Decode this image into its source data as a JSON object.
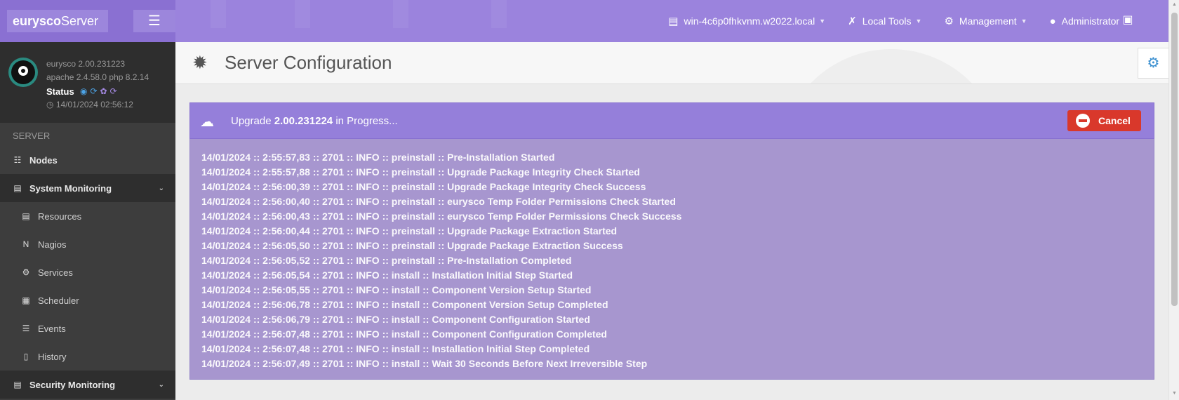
{
  "topbar": {
    "brand_bold": "eurysco",
    "brand_rest": "Server",
    "host": "win-4c6p0fhkvnm.w2022.local",
    "local_tools": "Local Tools",
    "management": "Management",
    "user": "Administrator"
  },
  "sidebar": {
    "version": "eurysco 2.00.231223",
    "stack": "apache 2.4.58.0  php 8.2.14",
    "status_label": "Status",
    "timestamp": "14/01/2024 02:56:12",
    "section": "SERVER",
    "items": [
      {
        "label": "Nodes",
        "icon": "sitemap-icon"
      },
      {
        "label": "System Monitoring",
        "icon": "monitor-icon"
      },
      {
        "label": "Resources",
        "icon": "server-icon"
      },
      {
        "label": "Nagios",
        "icon": "nagios-icon"
      },
      {
        "label": "Services",
        "icon": "cog-icon"
      },
      {
        "label": "Scheduler",
        "icon": "calendar-icon"
      },
      {
        "label": "Events",
        "icon": "list-icon"
      },
      {
        "label": "History",
        "icon": "book-icon"
      },
      {
        "label": "Security Monitoring",
        "icon": "shield-list-icon"
      }
    ]
  },
  "page": {
    "title": "Server Configuration"
  },
  "upgrade": {
    "prefix": "Upgrade",
    "version": "2.00.231224",
    "suffix": "in Progress...",
    "cancel_label": "Cancel"
  },
  "log_lines": [
    "14/01/2024 :: 2:55:57,83 :: 2701 :: INFO :: preinstall :: Pre-Installation Started",
    "14/01/2024 :: 2:55:57,88 :: 2701 :: INFO :: preinstall :: Upgrade Package Integrity Check Started",
    "14/01/2024 :: 2:56:00,39 :: 2701 :: INFO :: preinstall :: Upgrade Package Integrity Check Success",
    "14/01/2024 :: 2:56:00,40 :: 2701 :: INFO :: preinstall :: eurysco Temp Folder Permissions Check Started",
    "14/01/2024 :: 2:56:00,43 :: 2701 :: INFO :: preinstall :: eurysco Temp Folder Permissions Check Success",
    "14/01/2024 :: 2:56:00,44 :: 2701 :: INFO :: preinstall :: Upgrade Package Extraction Started",
    "14/01/2024 :: 2:56:05,50 :: 2701 :: INFO :: preinstall :: Upgrade Package Extraction Success",
    "14/01/2024 :: 2:56:05,52 :: 2701 :: INFO :: preinstall :: Pre-Installation Completed",
    "14/01/2024 :: 2:56:05,54 :: 2701 :: INFO :: install :: Installation Initial Step Started",
    "14/01/2024 :: 2:56:05,55 :: 2701 :: INFO :: install :: Component Version Setup Started",
    "14/01/2024 :: 2:56:06,78 :: 2701 :: INFO :: install :: Component Version Setup Completed",
    "14/01/2024 :: 2:56:06,79 :: 2701 :: INFO :: install :: Component Configuration Started",
    "14/01/2024 :: 2:56:07,48 :: 2701 :: INFO :: install :: Component Configuration Completed",
    "14/01/2024 :: 2:56:07,48 :: 2701 :: INFO :: install :: Installation Initial Step Completed",
    "14/01/2024 :: 2:56:07,49 :: 2701 :: INFO :: install :: Wait 30 Seconds Before Next Irreversible Step"
  ],
  "colors": {
    "topbar": "#9b83dd",
    "panel_header": "#957fda",
    "log_bg": "#a796cf",
    "cancel": "#d9382b",
    "sidebar": "#3d3d3d"
  }
}
